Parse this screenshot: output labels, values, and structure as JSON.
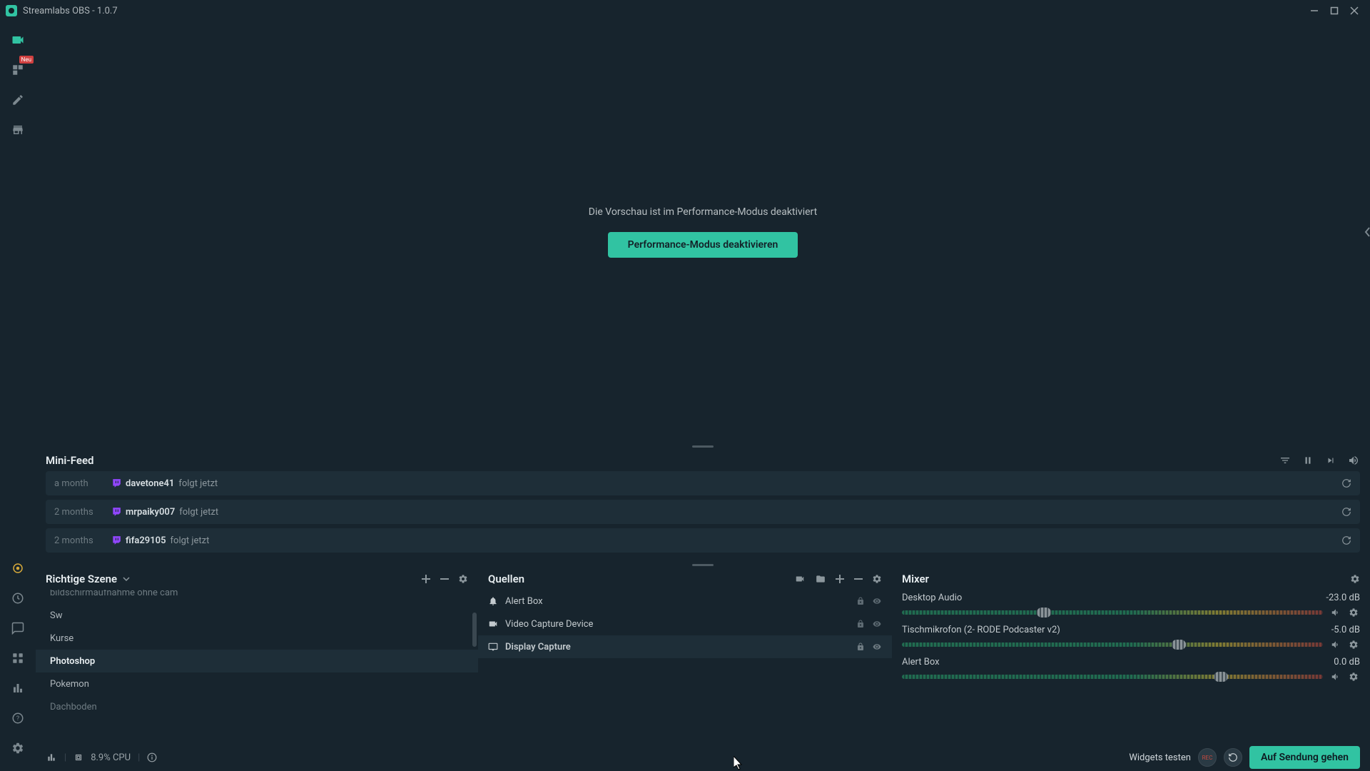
{
  "window": {
    "title": "Streamlabs OBS - 1.0.7"
  },
  "sidebar": {
    "neu_badge": "Neu"
  },
  "preview": {
    "message": "Die Vorschau ist im Performance-Modus deaktiviert",
    "button": "Performance-Modus deaktivieren"
  },
  "minifeed": {
    "title": "Mini-Feed",
    "items": [
      {
        "time": "a month",
        "user": "davetone41",
        "action": "folgt jetzt"
      },
      {
        "time": "2 months",
        "user": "mrpaiky007",
        "action": "folgt jetzt"
      },
      {
        "time": "2 months",
        "user": "fifa29105",
        "action": "folgt jetzt"
      }
    ]
  },
  "scenes": {
    "title": "Richtige Szene",
    "items": [
      {
        "label": "bildschirmaufnahme ohne cam",
        "faded": true
      },
      {
        "label": "Sw"
      },
      {
        "label": "Kurse"
      },
      {
        "label": "Photoshop",
        "selected": true
      },
      {
        "label": "Pokemon"
      },
      {
        "label": "Dachboden",
        "faded": true
      }
    ]
  },
  "sources": {
    "title": "Quellen",
    "items": [
      {
        "label": "Alert Box",
        "icon": "bell"
      },
      {
        "label": "Video Capture Device",
        "icon": "camera"
      },
      {
        "label": "Display Capture",
        "icon": "monitor",
        "selected": true
      }
    ]
  },
  "mixer": {
    "title": "Mixer",
    "items": [
      {
        "label": "Desktop Audio",
        "db": "-23.0 dB",
        "thumbPct": 32
      },
      {
        "label": "Tischmikrofon (2- RODE Podcaster v2)",
        "db": "-5.0 dB",
        "thumbPct": 64
      },
      {
        "label": "Alert Box",
        "db": "0.0 dB",
        "thumbPct": 74
      }
    ]
  },
  "status": {
    "cpu": "8.9% CPU",
    "widgets": "Widgets testen",
    "rec": "REC",
    "go_live": "Auf Sendung gehen"
  }
}
